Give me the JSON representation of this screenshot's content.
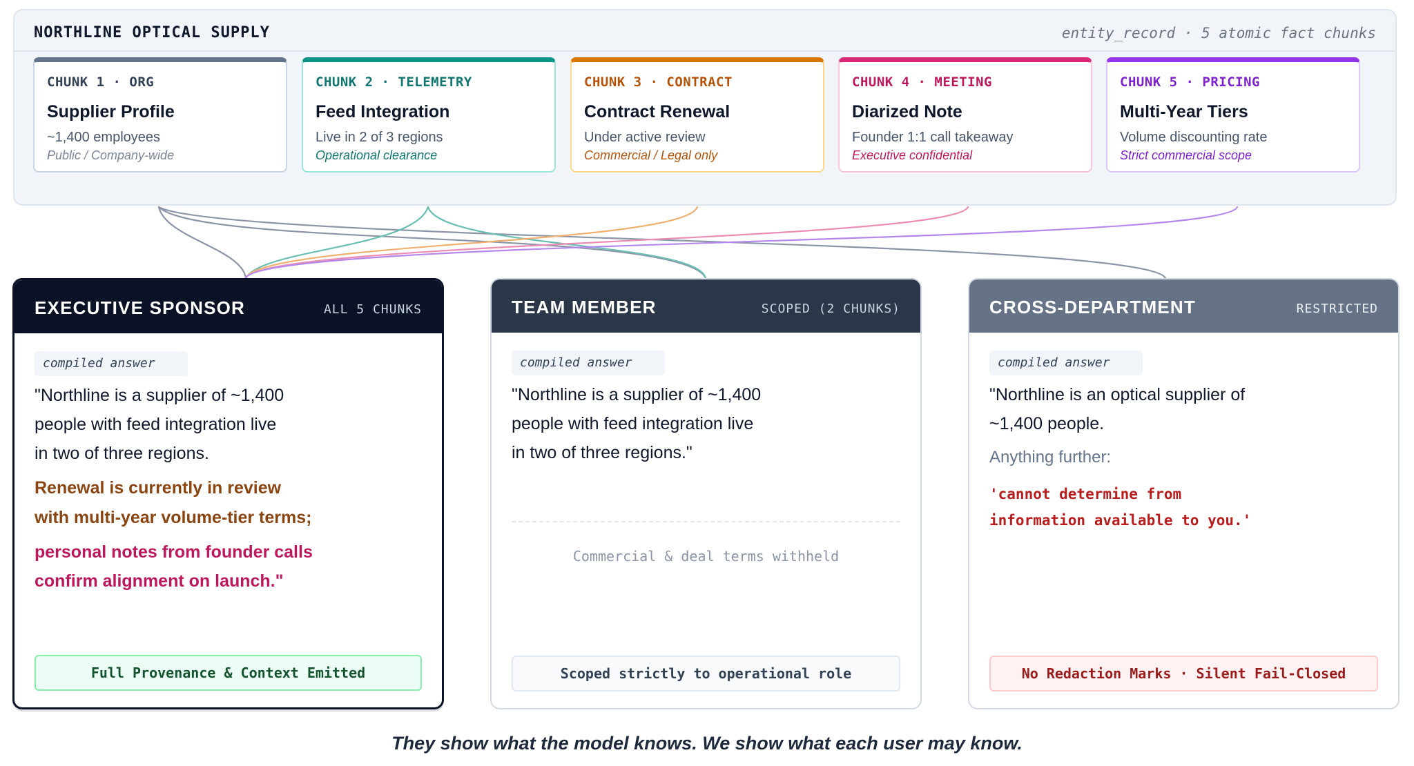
{
  "record": {
    "title": "NORTHLINE OPTICAL SUPPLY",
    "meta": "entity_record · 5 atomic fact chunks"
  },
  "chunks": [
    {
      "tag": "CHUNK 1 · ORG",
      "title": "Supplier Profile",
      "desc": "~1,400 employees",
      "scope": "Public / Company-wide",
      "accent": "#64748b",
      "tag_color": "#334155",
      "scope_color": "#7b8596",
      "border_color": "#cbd5e1"
    },
    {
      "tag": "CHUNK 2 · TELEMETRY",
      "title": "Feed Integration",
      "desc": "Live in 2 of 3 regions",
      "scope": "Operational clearance",
      "accent": "#0d9488",
      "tag_color": "#0f766e",
      "scope_color": "#0f766e",
      "border_color": "#99e6d8"
    },
    {
      "tag": "CHUNK 3 · CONTRACT",
      "title": "Contract Renewal",
      "desc": "Under active review",
      "scope": "Commercial / Legal only",
      "accent": "#d97706",
      "tag_color": "#b45309",
      "scope_color": "#b45309",
      "border_color": "#fcd989"
    },
    {
      "tag": "CHUNK 4 · MEETING",
      "title": "Diarized Note",
      "desc": "Founder 1:1 call takeaway",
      "scope": "Executive confidential",
      "accent": "#db2777",
      "tag_color": "#be185d",
      "scope_color": "#be185d",
      "border_color": "#f6c6dc"
    },
    {
      "tag": "CHUNK 5 · PRICING",
      "title": "Multi-Year Tiers",
      "desc": "Volume discounting rate",
      "scope": "Strict commercial scope",
      "accent": "#9333ea",
      "tag_color": "#7e22ce",
      "scope_color": "#7e22ce",
      "border_color": "#dcc8f5"
    }
  ],
  "roles": {
    "executive": {
      "title": "EXECUTIVE SPONSOR",
      "badge": "ALL 5 CHUNKS",
      "label": "compiled answer",
      "answer_lines": [
        "\"Northline is a supplier of ~1,400",
        "people with feed integration live",
        "in two of three regions."
      ],
      "contract_lines": [
        "Renewal is currently in review",
        "with multi-year volume-tier terms;"
      ],
      "meeting_lines": [
        "personal notes from founder calls",
        "confirm alignment on launch.\""
      ],
      "footer": "Full Provenance & Context Emitted",
      "header_color": "#0b1226"
    },
    "team": {
      "title": "TEAM MEMBER",
      "badge": "SCOPED (2 CHUNKS)",
      "label": "compiled answer",
      "answer_lines": [
        "\"Northline is a supplier of ~1,400",
        "people with feed integration live",
        "in two of three regions.\""
      ],
      "withheld": "Commercial & deal terms withheld",
      "footer": "Scoped strictly to operational role",
      "header_color": "#2b3648"
    },
    "cross": {
      "title": "CROSS-DEPARTMENT",
      "badge": "RESTRICTED",
      "label": "compiled answer",
      "answer_lines": [
        "\"Northline is an optical supplier of",
        "~1,400 people."
      ],
      "further": "Anything further:",
      "denied_lines": [
        "'cannot determine from",
        "information available to you.'"
      ],
      "footer": "No Redaction Marks · Silent Fail-Closed",
      "header_color": "#667387"
    }
  },
  "tagline": "They show what the model knows. We show what each user may know."
}
